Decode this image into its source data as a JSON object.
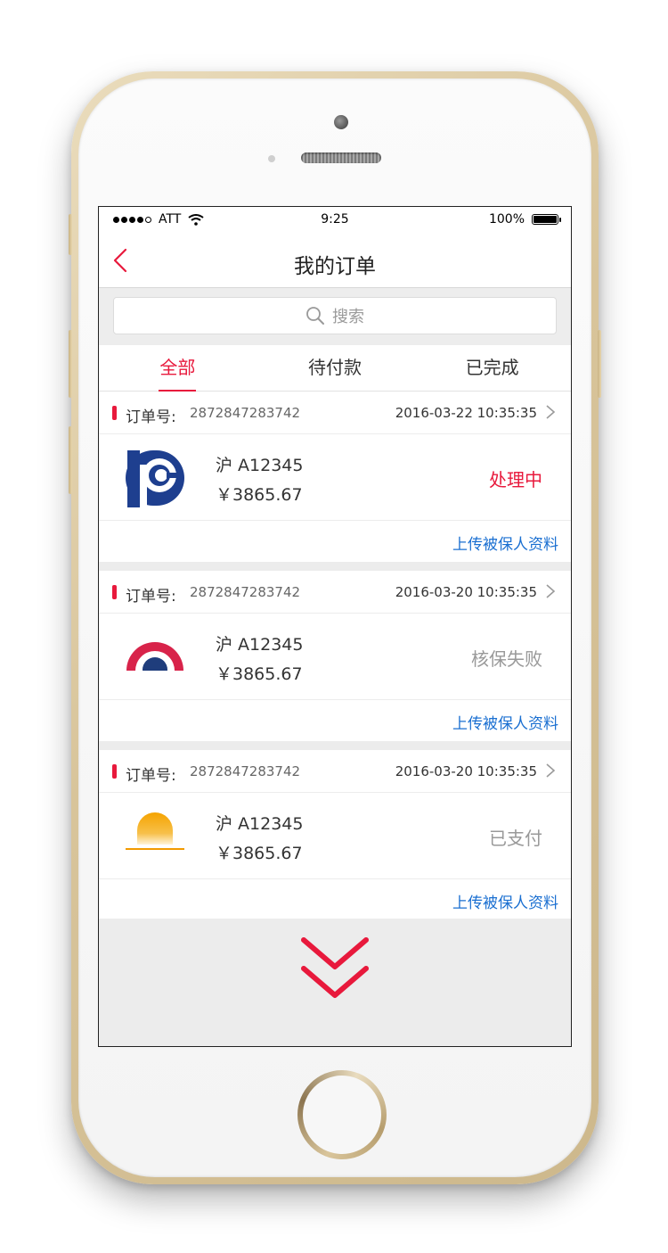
{
  "status_bar": {
    "carrier": "ATT",
    "time": "9:25",
    "battery": "100%"
  },
  "nav": {
    "title": "我的订单",
    "back_icon": "chevron-left-icon"
  },
  "search": {
    "placeholder": "搜索"
  },
  "tabs": [
    {
      "label": "全部",
      "active": true
    },
    {
      "label": "待付款",
      "active": false
    },
    {
      "label": "已完成",
      "active": false
    }
  ],
  "order_no_label": "订单号:",
  "upload_label": "上传被保人资料",
  "orders": [
    {
      "order_no": "2872847283742",
      "time": "2016-03-22   10:35:35",
      "plate": "沪 A12345",
      "price": "￥3865.67",
      "status": "处理中",
      "status_color": "#e8193c",
      "logo": "picc-logo"
    },
    {
      "order_no": "2872847283742",
      "time": "2016-03-20   10:35:35",
      "plate": "沪 A12345",
      "price": "￥3865.67",
      "status": "核保失败",
      "status_color": "#999999",
      "logo": "red-arch-logo"
    },
    {
      "order_no": "2872847283742",
      "time": "2016-03-20   10:35:35",
      "plate": "沪 A12345",
      "price": "￥3865.67",
      "status": "已支付",
      "status_color": "#999999",
      "logo": "sunrise-logo"
    }
  ],
  "colors": {
    "accent": "#e8193c",
    "link": "#1a6fd1"
  },
  "load_more_icon": "double-chevron-down-icon"
}
